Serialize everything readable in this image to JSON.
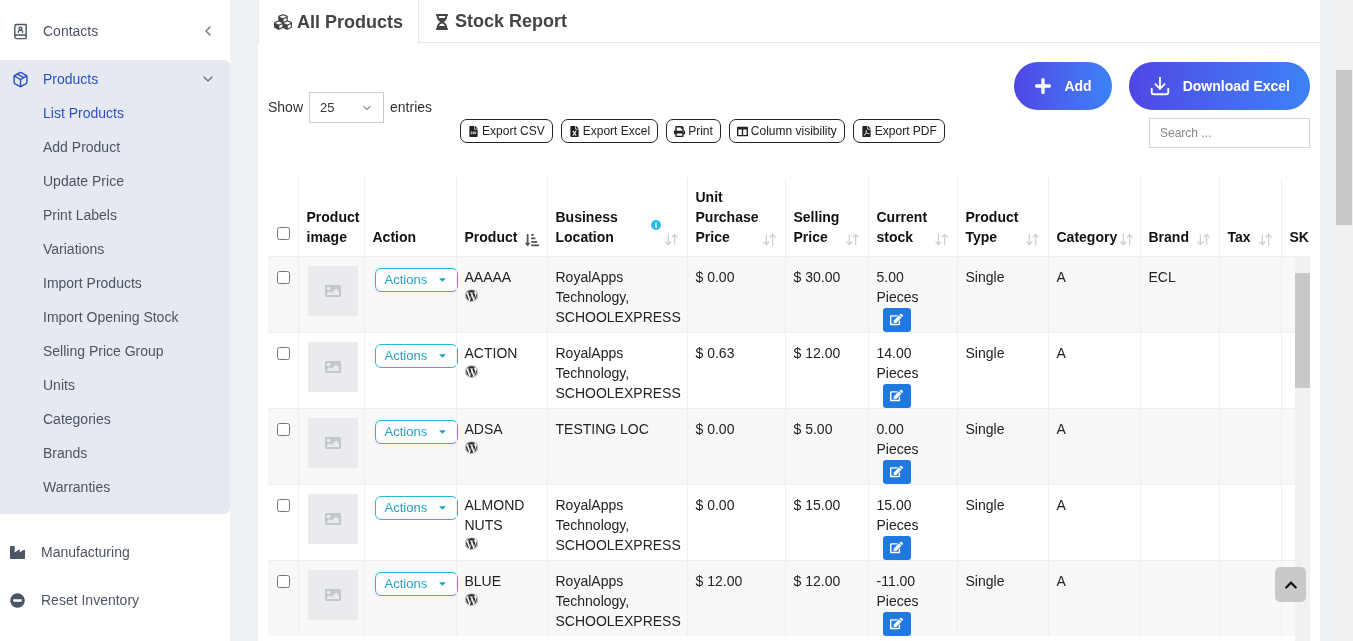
{
  "sidebar": {
    "items": [
      {
        "label": "Contacts",
        "kind": "group",
        "expanded": false,
        "selected": false
      },
      {
        "label": "Products",
        "kind": "group",
        "expanded": true,
        "selected": true,
        "children": [
          {
            "label": "List Products",
            "selected": true
          },
          {
            "label": "Add Product",
            "selected": false
          },
          {
            "label": "Update Price",
            "selected": false
          },
          {
            "label": "Print Labels",
            "selected": false
          },
          {
            "label": "Variations",
            "selected": false
          },
          {
            "label": "Import Products",
            "selected": false
          },
          {
            "label": "Import Opening Stock",
            "selected": false
          },
          {
            "label": "Selling Price Group",
            "selected": false
          },
          {
            "label": "Units",
            "selected": false
          },
          {
            "label": "Categories",
            "selected": false
          },
          {
            "label": "Brands",
            "selected": false
          },
          {
            "label": "Warranties",
            "selected": false
          }
        ]
      },
      {
        "label": "Manufacturing",
        "kind": "link",
        "selected": false
      },
      {
        "label": "Reset Inventory",
        "kind": "link",
        "selected": false
      }
    ]
  },
  "tabs": [
    {
      "label": "All Products",
      "selected": true
    },
    {
      "label": "Stock Report",
      "selected": false
    }
  ],
  "toolbar": {
    "show_label": "Show",
    "page_size": "25",
    "entries_label": "entries",
    "export_buttons": [
      "Export CSV",
      "Export Excel",
      "Print",
      "Column visibility",
      "Export PDF"
    ],
    "action_buttons": [
      "Add",
      "Download Excel"
    ],
    "search": {
      "placeholder": "Search ..."
    }
  },
  "table": {
    "select_all": {
      "checked": false
    },
    "columns": [
      {
        "label": "Product image",
        "kind": "plain",
        "info": false
      },
      {
        "label": "Action",
        "kind": "plain",
        "info": false
      },
      {
        "label": "Product",
        "kind": "sorted",
        "info": false
      },
      {
        "label": "Business Location",
        "kind": "sortable",
        "info": true
      },
      {
        "label": "Unit Purchase Price",
        "kind": "sortable",
        "info": false
      },
      {
        "label": "Selling Price",
        "kind": "sortable",
        "info": false
      },
      {
        "label": "Current stock",
        "kind": "sortable",
        "info": false
      },
      {
        "label": "Product Type",
        "kind": "sortable",
        "info": false
      },
      {
        "label": "Category",
        "kind": "sortable",
        "info": false
      },
      {
        "label": "Brand",
        "kind": "sortable",
        "info": false
      },
      {
        "label": "Tax",
        "kind": "sortable",
        "info": false
      },
      {
        "label": "SK",
        "kind": "plain",
        "info": false
      }
    ],
    "rows": [
      {
        "checked": false,
        "action": "Actions",
        "product": "AAAAA",
        "location": "RoyalApps Technology, SCHOOLEXPRESS",
        "purchase_price": "$ 0.00",
        "selling_price": "$ 30.00",
        "stock": "5.00 Pieces",
        "type": "Single",
        "category": "A",
        "brand": "ECL"
      },
      {
        "checked": false,
        "action": "Actions",
        "product": "ACTION",
        "location": "RoyalApps Technology, SCHOOLEXPRESS",
        "purchase_price": "$ 0.63",
        "selling_price": "$ 12.00",
        "stock": "14.00 Pieces",
        "type": "Single",
        "category": "A"
      },
      {
        "checked": false,
        "action": "Actions",
        "product": "ADSA",
        "location": "TESTING LOC",
        "purchase_price": "$ 0.00",
        "selling_price": "$ 5.00",
        "stock": "0.00 Pieces",
        "type": "Single",
        "category": "A"
      },
      {
        "checked": false,
        "action": "Actions",
        "product": "ALMOND NUTS",
        "location": "RoyalApps Technology, SCHOOLEXPRESS",
        "purchase_price": "$ 0.00",
        "selling_price": "$ 15.00",
        "stock": "15.00 Pieces",
        "type": "Single",
        "category": "A"
      },
      {
        "checked": false,
        "action": "Actions",
        "product": "BLUE",
        "location": "RoyalApps Technology, SCHOOLEXPRESS",
        "purchase_price": "$ 12.00",
        "selling_price": "$ 12.00",
        "stock": "-11.00 Pieces",
        "type": "Single",
        "category": "A"
      }
    ]
  }
}
